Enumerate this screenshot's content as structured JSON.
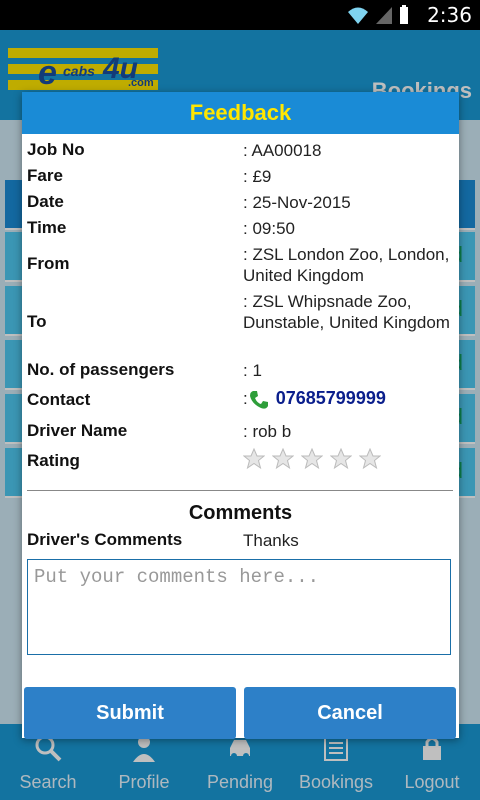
{
  "status": {
    "time": "2:36"
  },
  "header": {
    "title": "Bookings",
    "logo_text": "ecabs4u.com"
  },
  "dialog": {
    "title": "Feedback",
    "details": [
      {
        "label": "Job No",
        "value": ": AA00018"
      },
      {
        "label": "Fare",
        "value": ": £9"
      },
      {
        "label": "Date",
        "value": ": 25-Nov-2015"
      },
      {
        "label": "Time",
        "value": ": 09:50"
      },
      {
        "label": "From",
        "value": ": ZSL London Zoo, London, United Kingdom"
      },
      {
        "label": "To",
        "value": ": ZSL Whipsnade Zoo, Dunstable, United Kingdom"
      },
      {
        "label": "No. of passengers",
        "value": ": 1"
      },
      {
        "label": "Contact",
        "value": "07685799999"
      },
      {
        "label": "Driver Name",
        "value": ": rob b"
      },
      {
        "label": "Rating",
        "value": ""
      }
    ],
    "rating": {
      "value": 0,
      "max": 5
    },
    "comments_heading": "Comments",
    "drivers_comments_label": "Driver's Comments",
    "drivers_comments_value": "Thanks",
    "comment_placeholder": "Put your comments here...",
    "submit_label": "Submit",
    "cancel_label": "Cancel"
  },
  "bottom_nav": [
    {
      "label": "Search",
      "icon": "search-icon"
    },
    {
      "label": "Profile",
      "icon": "profile-icon"
    },
    {
      "label": "Pending",
      "icon": "car-icon"
    },
    {
      "label": "Bookings",
      "icon": "list-icon"
    },
    {
      "label": "Logout",
      "icon": "lock-icon"
    }
  ],
  "colors": {
    "accent": "#1a9ad6",
    "dialog_title_text": "#ffe600",
    "contact_number": "#0a1e8c",
    "button": "#2d80c8"
  }
}
